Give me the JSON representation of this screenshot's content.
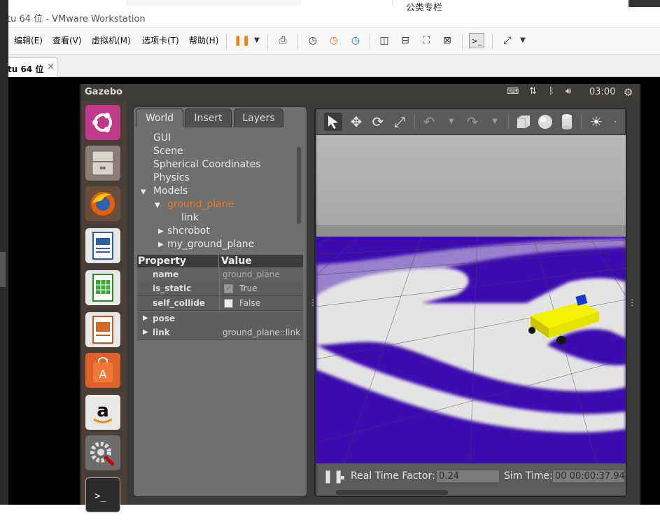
{
  "vmware": {
    "title": "tu 64 位 - VMware Workstation",
    "menu": [
      "编辑(E)",
      "查看(V)",
      "虚拟机(M)",
      "选项卡(T)",
      "帮助(H)"
    ],
    "tab_label": "tu 64 位",
    "tab_close": "×",
    "top_fragment": "公类专栏"
  },
  "ubuntu": {
    "app_name": "Gazebo",
    "clock": "03:00",
    "launcher_icons": [
      "ubuntu-icon",
      "files-icon",
      "firefox-icon",
      "writer-icon",
      "calc-icon",
      "impress-icon",
      "software-center-icon",
      "amazon-icon",
      "settings-icon",
      "terminal-icon"
    ]
  },
  "gazebo": {
    "tabs": [
      "World",
      "Insert",
      "Layers"
    ],
    "tree": {
      "gui": "GUI",
      "scene": "Scene",
      "spherical": "Spherical Coordinates",
      "physics": "Physics",
      "models": "Models",
      "ground_plane": "ground_plane",
      "link": "link",
      "shcrobot": "shcrobot",
      "my_ground_plane": "my_ground_plane"
    },
    "props": {
      "header_property": "Property",
      "header_value": "Value",
      "name_label": "name",
      "name_value": "ground_plane",
      "is_static_label": "is_static",
      "is_static_value": "True",
      "self_collide_label": "self_collide",
      "self_collide_value": "False",
      "pose_label": "pose",
      "link_label": "link",
      "link_value": "ground_plane::link"
    },
    "bottom": {
      "rtf_label": "Real Time Factor:",
      "rtf_value": "0.24",
      "sim_label": "Sim Time:",
      "sim_value": "00 00:00:37.942"
    },
    "colors": {
      "floor_purple": "#3d0ab0",
      "robot_yellow": "#f2ee10",
      "accent_orange": "#f07a1e"
    }
  }
}
